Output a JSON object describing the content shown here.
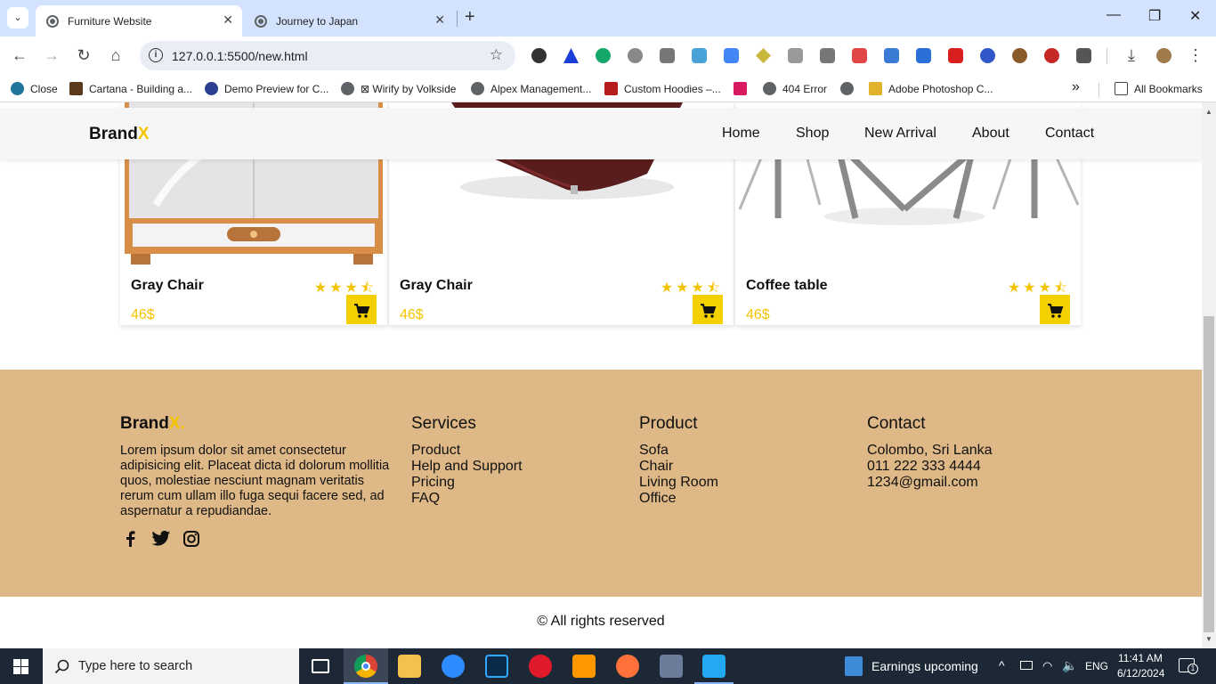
{
  "browser": {
    "tabs": [
      {
        "title": "Furniture Website",
        "active": true
      },
      {
        "title": "Journey to Japan",
        "active": false
      }
    ],
    "url": "127.0.0.1:5500/new.html",
    "bookmarks": [
      "Close",
      "Cartana - Building a...",
      "Demo Preview for C...",
      "⊠ Wirify by Volkside",
      "Alpex Management...",
      "Custom Hoodies –...",
      "404 Error",
      "Adobe Photoshop C..."
    ],
    "all_bookmarks_label": "All Bookmarks",
    "more_label": "»"
  },
  "navbar": {
    "brand_main": "Brand",
    "brand_accent": "X",
    "links": [
      "Home",
      "Shop",
      "New Arrival",
      "About",
      "Contact"
    ]
  },
  "products": [
    {
      "name": "Gray Chair",
      "price": "46$",
      "rating": 3.5
    },
    {
      "name": "Gray Chair",
      "price": "46$",
      "rating": 3.5
    },
    {
      "name": "Coffee table",
      "price": "46$",
      "rating": 3.5
    }
  ],
  "footer": {
    "brand_main": "Brand",
    "brand_accent": "X.",
    "description": "Lorem ipsum dolor sit amet consectetur adipisicing elit. Placeat dicta id dolorum mollitia quos, molestiae nesciunt magnam veritatis rerum cum ullam illo fuga sequi facere sed, ad aspernatur a repudiandae.",
    "services": {
      "title": "Services",
      "items": [
        "Product",
        "Help and Support",
        "Pricing",
        "FAQ"
      ]
    },
    "product": {
      "title": "Product",
      "items": [
        "Sofa",
        "Chair",
        "Living Room",
        "Office"
      ]
    },
    "contact": {
      "title": "Contact",
      "items": [
        "Colombo, Sri Lanka",
        "011 222 333 4444",
        "1234@gmail.com"
      ]
    },
    "copyright": "© All rights reserved"
  },
  "taskbar": {
    "search_placeholder": "Type here to search",
    "news": "Earnings upcoming",
    "lang": "ENG",
    "time": "11:41 AM",
    "date": "6/12/2024",
    "notif_count": "1"
  },
  "colors": {
    "accent": "#f5c400",
    "footer_bg": "#deb887"
  }
}
